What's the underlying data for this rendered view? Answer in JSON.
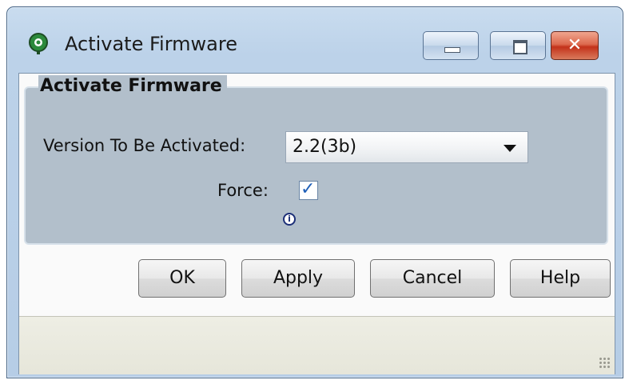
{
  "window": {
    "title": "Activate Firmware",
    "controls": {
      "minimize_icon": "minimize-icon",
      "maximize_icon": "maximize-icon",
      "close_icon": "close-icon"
    },
    "accent": "#c3321a"
  },
  "form": {
    "legend": "Activate Firmware",
    "version_label": "Version To Be Activated:",
    "version_value": "2.2(3b)",
    "force_label": "Force:",
    "force_checked": true,
    "info_icon": "info-icon"
  },
  "buttons": {
    "ok": "OK",
    "apply": "Apply",
    "cancel": "Cancel",
    "help": "Help"
  }
}
